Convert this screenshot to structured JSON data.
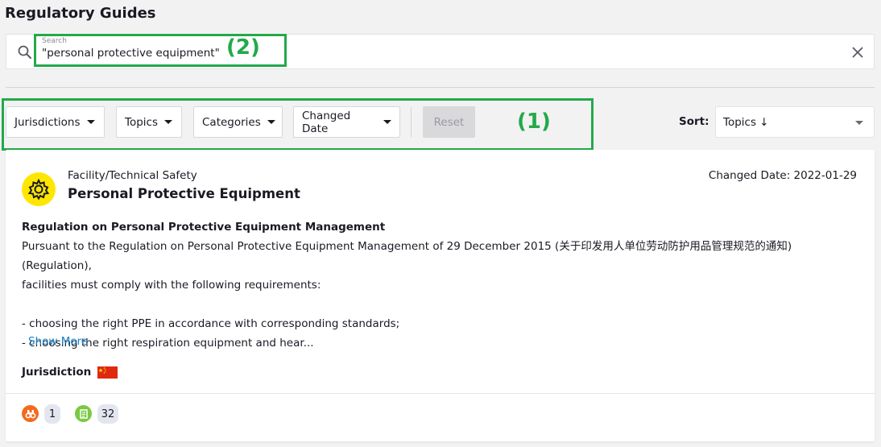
{
  "page": {
    "title": "Regulatory Guides"
  },
  "search": {
    "label": "Search",
    "value": "\"personal protective equipment\"",
    "search_icon": "search-icon",
    "clear_icon": "close-icon"
  },
  "annotations": {
    "filters": "(1)",
    "search": "(2)",
    "color": "#23a94a"
  },
  "filters": {
    "buttons": [
      {
        "label": "Jurisdictions"
      },
      {
        "label": "Topics"
      },
      {
        "label": "Categories"
      },
      {
        "label": "Changed Date"
      }
    ],
    "reset_label": "Reset"
  },
  "sort": {
    "label": "Sort:",
    "value": "Topics ↓"
  },
  "result": {
    "category": "Facility/Technical Safety",
    "title": "Personal Protective Equipment",
    "changed_date": "Changed Date: 2022-01-29",
    "subtitle": "Regulation on Personal Protective Equipment Management",
    "body_lines": [
      "Pursuant to the Regulation on Personal Protective Equipment Management of 29 December 2015 (关于印发用人单位劳动防护用品管理规范的通知) (Regulation),",
      "facilities must comply with the following requirements:",
      "",
      "- choosing the right PPE in accordance with corresponding standards;",
      "- choosing the right respiration equipment and hear..."
    ],
    "show_more": "Show More",
    "jurisdiction_label": "Jurisdiction",
    "jurisdiction_flag": "China flag",
    "stats": [
      {
        "icon": "binoculars-icon",
        "count": "1",
        "color": "#f26b1d"
      },
      {
        "icon": "document-icon",
        "count": "32",
        "color": "#7ac943"
      }
    ],
    "category_icon_color": "#ffe600"
  }
}
